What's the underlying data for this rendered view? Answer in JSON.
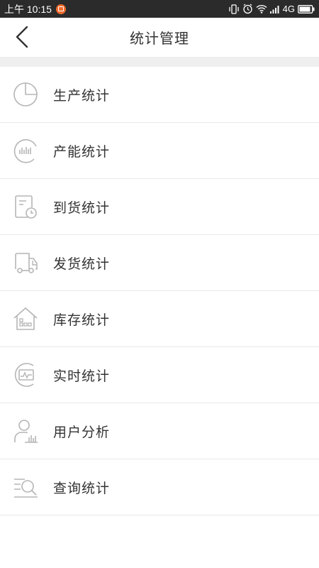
{
  "status_bar": {
    "time": "上午 10:15",
    "network": "4G",
    "notification_icon": "app-notification-icon"
  },
  "header": {
    "title": "统计管理",
    "back_icon": "chevron-left-icon"
  },
  "menu": {
    "items": [
      {
        "label": "生产统计",
        "icon": "pie-chart-icon"
      },
      {
        "label": "产能统计",
        "icon": "capacity-gauge-icon"
      },
      {
        "label": "到货统计",
        "icon": "arrival-doc-clock-icon"
      },
      {
        "label": "发货统计",
        "icon": "delivery-truck-icon"
      },
      {
        "label": "库存统计",
        "icon": "warehouse-icon"
      },
      {
        "label": "实时统计",
        "icon": "realtime-monitor-icon"
      },
      {
        "label": "用户分析",
        "icon": "user-analysis-icon"
      },
      {
        "label": "查询统计",
        "icon": "search-list-icon"
      }
    ]
  },
  "colors": {
    "status_bar_bg": "#2b2b2b",
    "icon_stroke": "#b5b5b5",
    "divider": "#e8e8e8",
    "section_gap": "#efefef",
    "notification_badge": "#f06b2c"
  }
}
